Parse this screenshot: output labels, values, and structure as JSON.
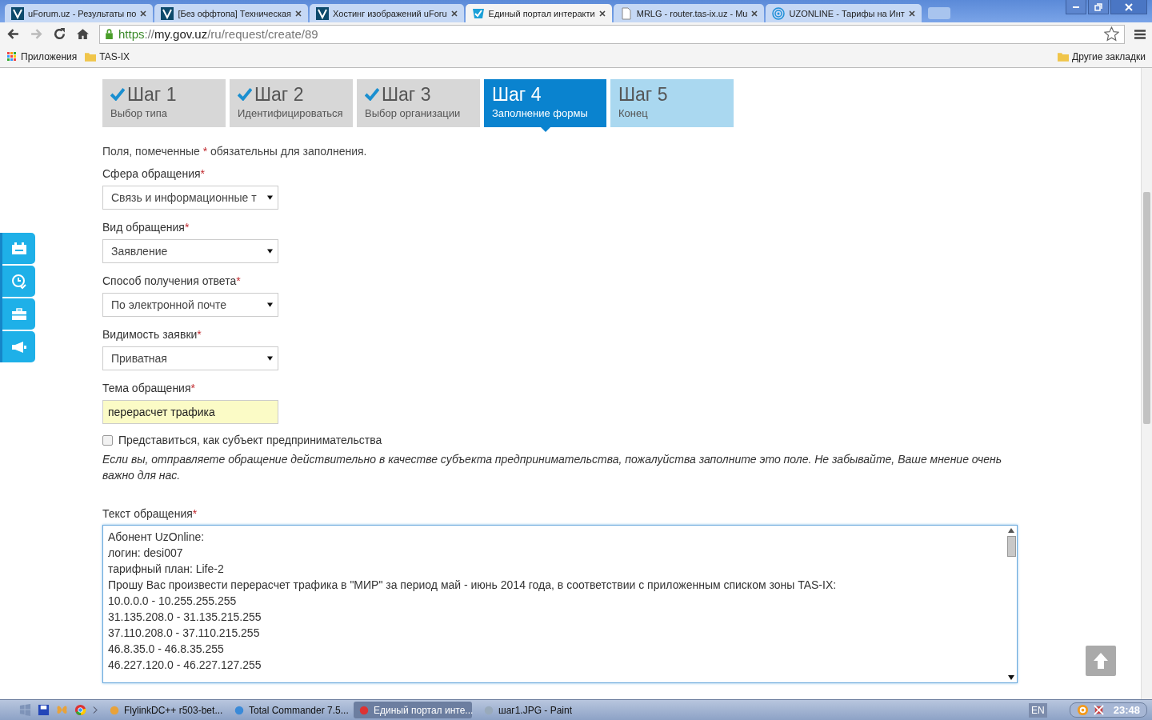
{
  "browser": {
    "tabs": [
      {
        "title": "uForum.uz - Результаты по",
        "kind": "v",
        "selected": false
      },
      {
        "title": "[Без оффтопа] Техническая",
        "kind": "v",
        "selected": false
      },
      {
        "title": "Хостинг изображений uForu",
        "kind": "v",
        "selected": false
      },
      {
        "title": "Единый портал интеракти",
        "kind": "portal",
        "selected": true
      },
      {
        "title": "MRLG - router.tas-ix.uz - Mu",
        "kind": "page",
        "selected": false
      },
      {
        "title": "UZONLINE - Тарифы на Инт",
        "kind": "wave",
        "selected": false
      }
    ],
    "address": {
      "scheme": "https",
      "sep": "://",
      "host": "my.gov.uz",
      "path": "/ru/request/create/89"
    },
    "bookmarks": [
      {
        "label": "Приложения",
        "kind": "apps"
      },
      {
        "label": "TAS-IX",
        "kind": "folder"
      }
    ],
    "other_bookmarks": "Другие закладки"
  },
  "steps": [
    {
      "title": "Шаг 1",
      "subtitle": "Выбор типа",
      "done": true,
      "selected": false
    },
    {
      "title": "Шаг 2",
      "subtitle": "Идентифицироваться",
      "done": true,
      "selected": false
    },
    {
      "title": "Шаг 3",
      "subtitle": "Выбор организации",
      "done": true,
      "selected": false
    },
    {
      "title": "Шаг 4",
      "subtitle": "Заполнение формы",
      "done": false,
      "selected": true
    },
    {
      "title": "Шаг 5",
      "subtitle": "Конец",
      "done": false,
      "selected": false
    }
  ],
  "required_note": {
    "before": "Поля, помеченные",
    "mark": "*",
    "after": "обязательны для заполнения."
  },
  "fields": [
    {
      "kind": "select",
      "label": "Сфера обращения",
      "required": true,
      "value": "Связь и информационные т"
    },
    {
      "kind": "select",
      "label": "Вид обращения",
      "required": true,
      "value": "Заявление"
    },
    {
      "kind": "select",
      "label": "Способ получения ответа",
      "required": true,
      "value": "По электронной почте"
    },
    {
      "kind": "select",
      "label": "Видимость заявки",
      "required": true,
      "value": "Приватная"
    },
    {
      "kind": "text",
      "label": "Тема обращения",
      "required": true,
      "value": "перерасчет трафика"
    }
  ],
  "entrepreneur": {
    "label": "Представиться, как субъект предпринимательства",
    "checked": false,
    "hint": "Если вы, отправляете обращение действительно в качестве субъекта предпринимательства, пожалуйства заполните это поле. Не забывайте, Ваше мнение очень важно для нас."
  },
  "message": {
    "label": "Текст обращения",
    "required": true,
    "lines": [
      "Абонент UzOnline:",
      "логин: desi007",
      "тарифный план: Life-2",
      "Прошу Вас произвести перерасчет трафика в \"МИР\" за период май - июнь 2014 года, в соответствии с приложенным списком зоны TAS-IX:",
      "10.0.0.0 - 10.255.255.255",
      "31.135.208.0 - 31.135.215.255",
      "37.110.208.0 - 37.110.215.255",
      "46.8.35.0 - 46.8.35.255",
      "46.227.120.0 - 46.227.127.255"
    ]
  },
  "taskbar": {
    "items": [
      {
        "title": "FlylinkDC++ r503-bet...",
        "selected": false
      },
      {
        "title": "Total Commander 7.5...",
        "selected": false
      },
      {
        "title": "Единый портал инте...",
        "selected": true
      },
      {
        "title": "шаг1.JPG - Paint",
        "selected": false
      }
    ],
    "language": "EN",
    "clock": "23:48"
  }
}
